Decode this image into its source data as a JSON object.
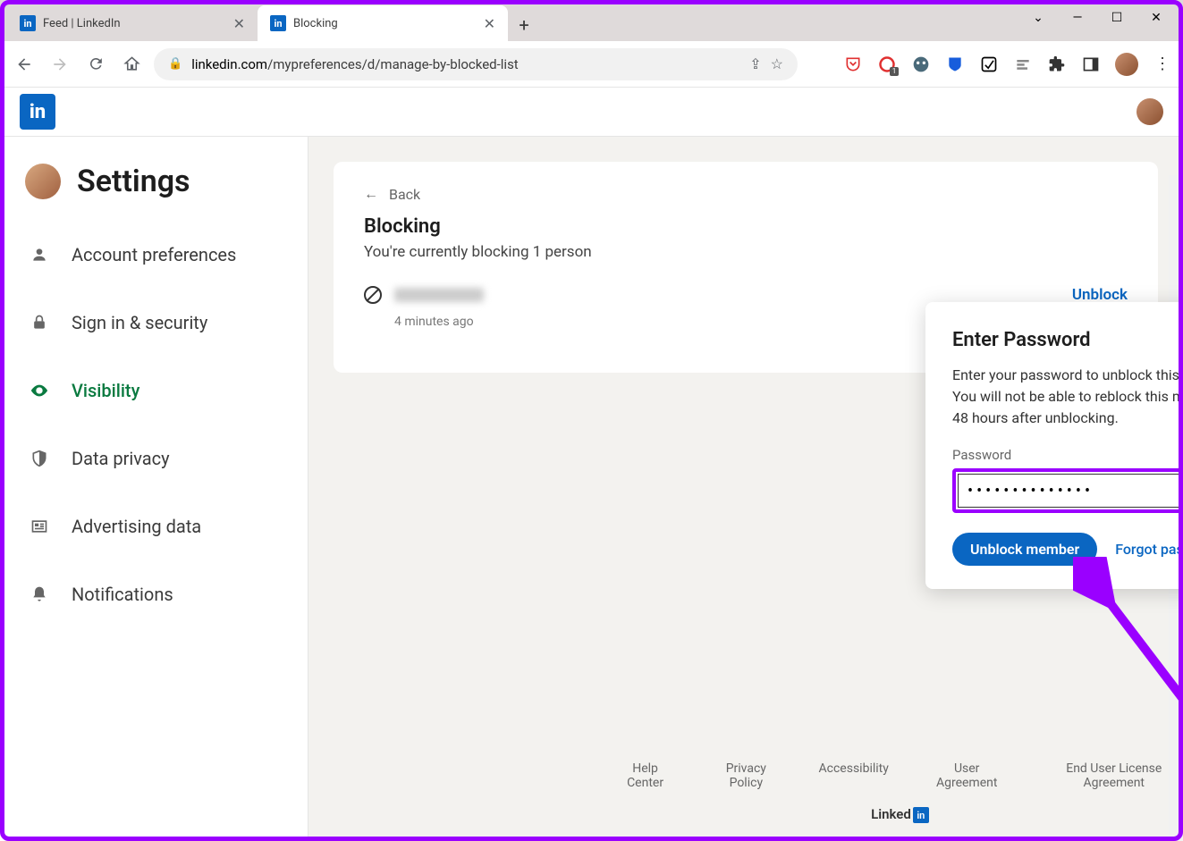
{
  "window": {
    "chevron": "⌄",
    "min": "—",
    "max": "☐",
    "close": "✕"
  },
  "tabs": [
    {
      "title": "Feed | LinkedIn",
      "active": false
    },
    {
      "title": "Blocking",
      "active": true
    }
  ],
  "url": {
    "domain": "linkedin.com",
    "path": "/mypreferences/d/manage-by-blocked-list"
  },
  "settings_title": "Settings",
  "nav": [
    {
      "label": "Account preferences"
    },
    {
      "label": "Sign in & security"
    },
    {
      "label": "Visibility"
    },
    {
      "label": "Data privacy"
    },
    {
      "label": "Advertising data"
    },
    {
      "label": "Notifications"
    }
  ],
  "card": {
    "back": "Back",
    "title": "Blocking",
    "subtitle": "You're currently blocking 1 person",
    "blocked_time": "4 minutes ago",
    "unblock": "Unblock"
  },
  "modal": {
    "title": "Enter Password",
    "desc": "Enter your password to unblock this member. You will not be able to reblock this member for 48 hours after unblocking.",
    "label": "Password",
    "value": "••••••••••••••",
    "submit": "Unblock member",
    "forgot": "Forgot password"
  },
  "footer": [
    "Help Center",
    "Privacy Policy",
    "Accessibility",
    "User Agreement",
    "End User License Agreement"
  ],
  "footer_brand": "Linked"
}
